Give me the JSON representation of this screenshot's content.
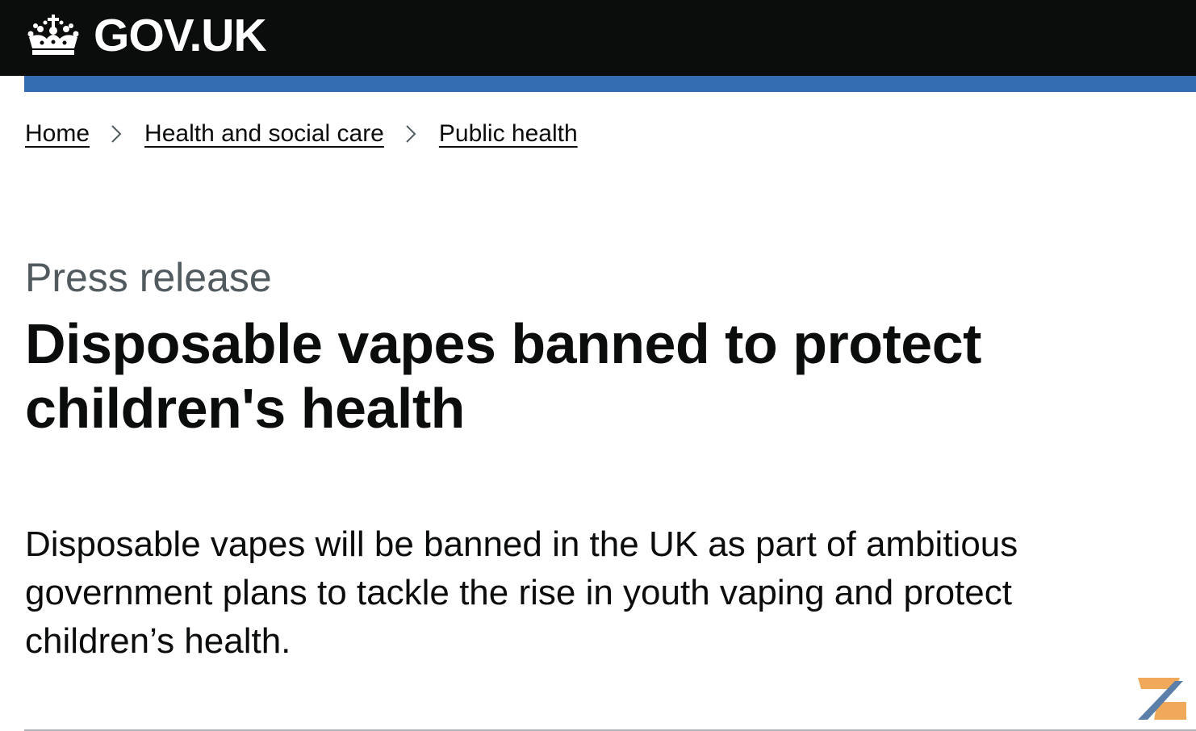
{
  "header": {
    "logo_text": "GOV.UK",
    "logo_icon": "crown-icon",
    "background": "#0b0c0c",
    "accent_bar": "#356db2"
  },
  "breadcrumbs": [
    {
      "label": "Home"
    },
    {
      "label": "Health and social care"
    },
    {
      "label": "Public health"
    }
  ],
  "article": {
    "caption": "Press release",
    "title": "Disposable vapes banned to protect children's health",
    "lead": "Disposable vapes will be banned in the UK as part of ambitious government plans to tackle the rise in youth vaping and protect children’s health."
  },
  "watermark_icon": "brand-logo-icon"
}
